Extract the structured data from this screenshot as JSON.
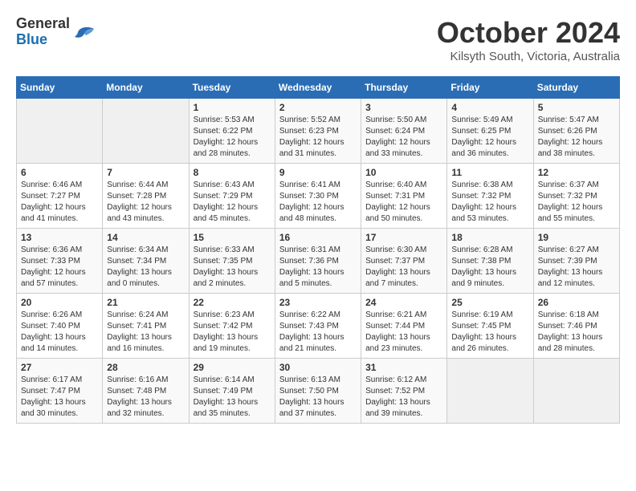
{
  "logo": {
    "general": "General",
    "blue": "Blue"
  },
  "title": "October 2024",
  "subtitle": "Kilsyth South, Victoria, Australia",
  "weekdays": [
    "Sunday",
    "Monday",
    "Tuesday",
    "Wednesday",
    "Thursday",
    "Friday",
    "Saturday"
  ],
  "weeks": [
    [
      {
        "day": "",
        "info": ""
      },
      {
        "day": "",
        "info": ""
      },
      {
        "day": "1",
        "info": "Sunrise: 5:53 AM\nSunset: 6:22 PM\nDaylight: 12 hours and 28 minutes."
      },
      {
        "day": "2",
        "info": "Sunrise: 5:52 AM\nSunset: 6:23 PM\nDaylight: 12 hours and 31 minutes."
      },
      {
        "day": "3",
        "info": "Sunrise: 5:50 AM\nSunset: 6:24 PM\nDaylight: 12 hours and 33 minutes."
      },
      {
        "day": "4",
        "info": "Sunrise: 5:49 AM\nSunset: 6:25 PM\nDaylight: 12 hours and 36 minutes."
      },
      {
        "day": "5",
        "info": "Sunrise: 5:47 AM\nSunset: 6:26 PM\nDaylight: 12 hours and 38 minutes."
      }
    ],
    [
      {
        "day": "6",
        "info": "Sunrise: 6:46 AM\nSunset: 7:27 PM\nDaylight: 12 hours and 41 minutes."
      },
      {
        "day": "7",
        "info": "Sunrise: 6:44 AM\nSunset: 7:28 PM\nDaylight: 12 hours and 43 minutes."
      },
      {
        "day": "8",
        "info": "Sunrise: 6:43 AM\nSunset: 7:29 PM\nDaylight: 12 hours and 45 minutes."
      },
      {
        "day": "9",
        "info": "Sunrise: 6:41 AM\nSunset: 7:30 PM\nDaylight: 12 hours and 48 minutes."
      },
      {
        "day": "10",
        "info": "Sunrise: 6:40 AM\nSunset: 7:31 PM\nDaylight: 12 hours and 50 minutes."
      },
      {
        "day": "11",
        "info": "Sunrise: 6:38 AM\nSunset: 7:32 PM\nDaylight: 12 hours and 53 minutes."
      },
      {
        "day": "12",
        "info": "Sunrise: 6:37 AM\nSunset: 7:32 PM\nDaylight: 12 hours and 55 minutes."
      }
    ],
    [
      {
        "day": "13",
        "info": "Sunrise: 6:36 AM\nSunset: 7:33 PM\nDaylight: 12 hours and 57 minutes."
      },
      {
        "day": "14",
        "info": "Sunrise: 6:34 AM\nSunset: 7:34 PM\nDaylight: 13 hours and 0 minutes."
      },
      {
        "day": "15",
        "info": "Sunrise: 6:33 AM\nSunset: 7:35 PM\nDaylight: 13 hours and 2 minutes."
      },
      {
        "day": "16",
        "info": "Sunrise: 6:31 AM\nSunset: 7:36 PM\nDaylight: 13 hours and 5 minutes."
      },
      {
        "day": "17",
        "info": "Sunrise: 6:30 AM\nSunset: 7:37 PM\nDaylight: 13 hours and 7 minutes."
      },
      {
        "day": "18",
        "info": "Sunrise: 6:28 AM\nSunset: 7:38 PM\nDaylight: 13 hours and 9 minutes."
      },
      {
        "day": "19",
        "info": "Sunrise: 6:27 AM\nSunset: 7:39 PM\nDaylight: 13 hours and 12 minutes."
      }
    ],
    [
      {
        "day": "20",
        "info": "Sunrise: 6:26 AM\nSunset: 7:40 PM\nDaylight: 13 hours and 14 minutes."
      },
      {
        "day": "21",
        "info": "Sunrise: 6:24 AM\nSunset: 7:41 PM\nDaylight: 13 hours and 16 minutes."
      },
      {
        "day": "22",
        "info": "Sunrise: 6:23 AM\nSunset: 7:42 PM\nDaylight: 13 hours and 19 minutes."
      },
      {
        "day": "23",
        "info": "Sunrise: 6:22 AM\nSunset: 7:43 PM\nDaylight: 13 hours and 21 minutes."
      },
      {
        "day": "24",
        "info": "Sunrise: 6:21 AM\nSunset: 7:44 PM\nDaylight: 13 hours and 23 minutes."
      },
      {
        "day": "25",
        "info": "Sunrise: 6:19 AM\nSunset: 7:45 PM\nDaylight: 13 hours and 26 minutes."
      },
      {
        "day": "26",
        "info": "Sunrise: 6:18 AM\nSunset: 7:46 PM\nDaylight: 13 hours and 28 minutes."
      }
    ],
    [
      {
        "day": "27",
        "info": "Sunrise: 6:17 AM\nSunset: 7:47 PM\nDaylight: 13 hours and 30 minutes."
      },
      {
        "day": "28",
        "info": "Sunrise: 6:16 AM\nSunset: 7:48 PM\nDaylight: 13 hours and 32 minutes."
      },
      {
        "day": "29",
        "info": "Sunrise: 6:14 AM\nSunset: 7:49 PM\nDaylight: 13 hours and 35 minutes."
      },
      {
        "day": "30",
        "info": "Sunrise: 6:13 AM\nSunset: 7:50 PM\nDaylight: 13 hours and 37 minutes."
      },
      {
        "day": "31",
        "info": "Sunrise: 6:12 AM\nSunset: 7:52 PM\nDaylight: 13 hours and 39 minutes."
      },
      {
        "day": "",
        "info": ""
      },
      {
        "day": "",
        "info": ""
      }
    ]
  ]
}
